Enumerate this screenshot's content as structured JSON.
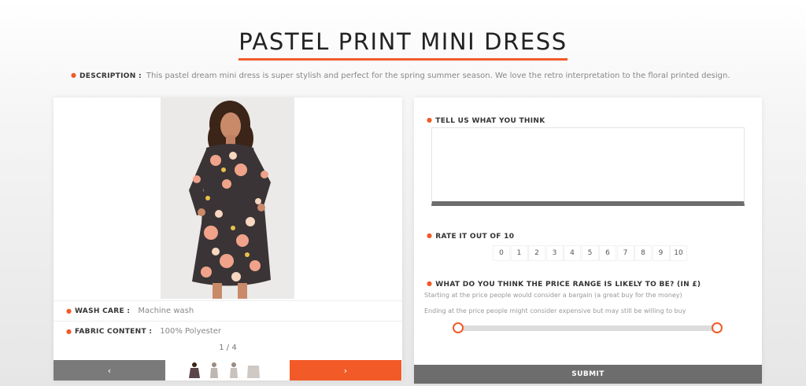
{
  "product": {
    "title": "PASTEL PRINT MINI DRESS",
    "description_label": "DESCRIPTION :",
    "description": "This pastel dream mini dress is super stylish and perfect for the spring summer season. We love the retro interpretation to the floral printed design.",
    "wash_care_label": "WASH CARE :",
    "wash_care": "Machine wash",
    "fabric_label": "FABRIC CONTENT :",
    "fabric": "100% Polyester",
    "pager": "1 / 4",
    "prev_label": "‹",
    "next_label": "›"
  },
  "form": {
    "think_label": "TELL US WHAT YOU THINK",
    "feedback_value": "",
    "rate_label": "RATE IT OUT OF 10",
    "rating_options": [
      "0",
      "1",
      "2",
      "3",
      "4",
      "5",
      "6",
      "7",
      "8",
      "9",
      "10"
    ],
    "price_label": "WHAT DO YOU THINK THE PRICE RANGE IS LIKELY TO BE? (IN £)",
    "hint_bargain": "Starting at the price people would consider a bargain (a great buy for the money)",
    "hint_expensive": "Ending at the price people might consider expensive but may still be willing to buy",
    "slider_min_position": 0,
    "slider_max_position": 1,
    "submit_label": "SUBMIT"
  },
  "colors": {
    "accent": "#f25a28",
    "dark_button": "#6d6d6d"
  }
}
